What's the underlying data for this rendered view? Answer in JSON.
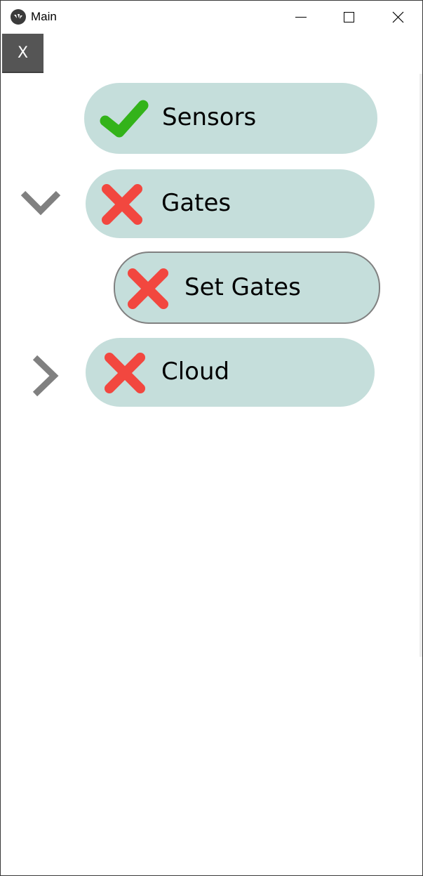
{
  "window": {
    "title": "Main",
    "app_icon": "kivy-logo-icon",
    "controls": {
      "minimize_icon": "minimize-icon",
      "maximize_icon": "maximize-icon",
      "close_icon": "close-icon"
    }
  },
  "toolbar": {
    "close_label": "X"
  },
  "tree": {
    "items": [
      {
        "label": "Sensors",
        "status": "ok",
        "status_icon": "checkmark-icon",
        "expander": "none"
      },
      {
        "label": "Gates",
        "status": "error",
        "status_icon": "cross-icon",
        "expander": "chevron-down-icon"
      },
      {
        "label": "Set Gates",
        "status": "error",
        "status_icon": "cross-icon",
        "expander": "none",
        "selected": true
      },
      {
        "label": "Cloud",
        "status": "error",
        "status_icon": "cross-icon",
        "expander": "chevron-right-icon"
      }
    ]
  },
  "colors": {
    "pill_bg": "#c5dedb",
    "ok": "#33b31a",
    "error": "#f2473f",
    "chevron": "#808080",
    "close_button_bg": "#555555"
  }
}
